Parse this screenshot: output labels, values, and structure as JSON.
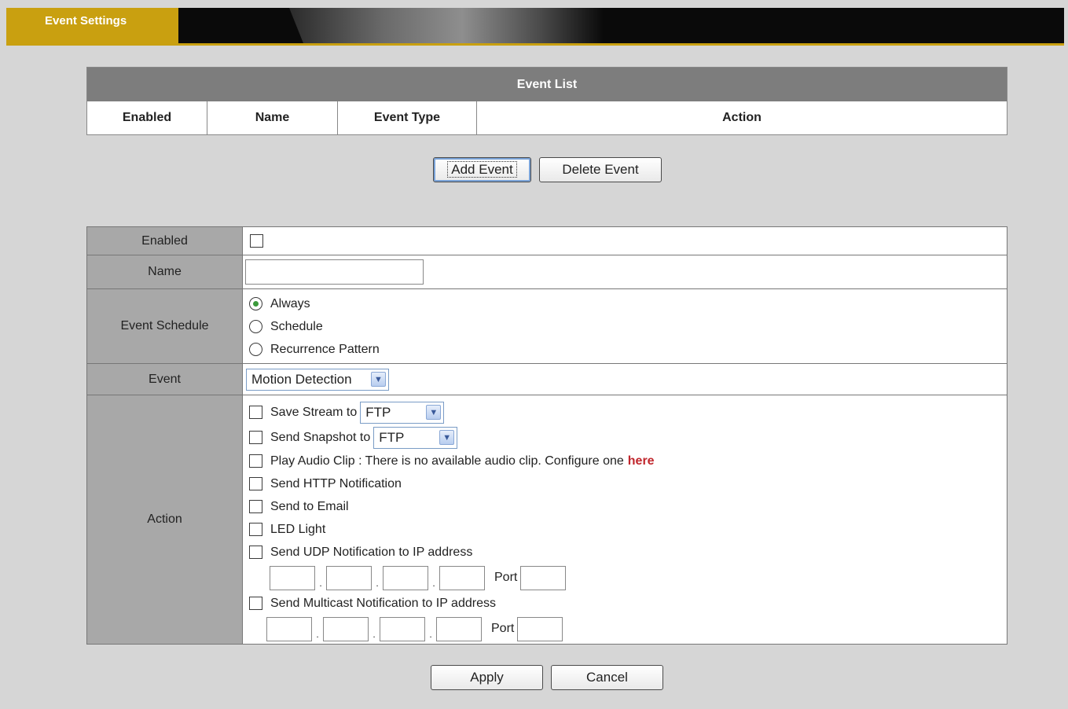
{
  "header": {
    "tab_label": "Event Settings"
  },
  "event_list": {
    "caption": "Event List",
    "columns": [
      "Enabled",
      "Name",
      "Event Type",
      "Action"
    ]
  },
  "list_buttons": {
    "add": "Add Event",
    "delete": "Delete Event"
  },
  "form": {
    "enabled_label": "Enabled",
    "name_label": "Name",
    "name_value": "",
    "schedule_label": "Event Schedule",
    "schedule_options": [
      "Always",
      "Schedule",
      "Recurrence Pattern"
    ],
    "schedule_selected": "Always",
    "event_label": "Event",
    "event_value": "Motion Detection",
    "action_label": "Action",
    "actions": {
      "save_stream": "Save Stream to",
      "save_stream_target": "FTP",
      "send_snapshot": "Send Snapshot to",
      "send_snapshot_target": "FTP",
      "play_audio": "Play Audio Clip : There is no available audio clip. Configure one",
      "play_audio_link": "here",
      "http": "Send HTTP Notification",
      "email": "Send to Email",
      "led": "LED Light",
      "udp": "Send UDP Notification to IP address",
      "multicast": "Send Multicast Notification to IP address",
      "port_label": "Port",
      "ip_separator": "."
    }
  },
  "footer": {
    "apply": "Apply",
    "cancel": "Cancel"
  },
  "colors": {
    "accent": "#c9a010",
    "link": "#c0262c",
    "label_bg": "#a8a8a8",
    "header_bg": "#7d7d7d"
  }
}
